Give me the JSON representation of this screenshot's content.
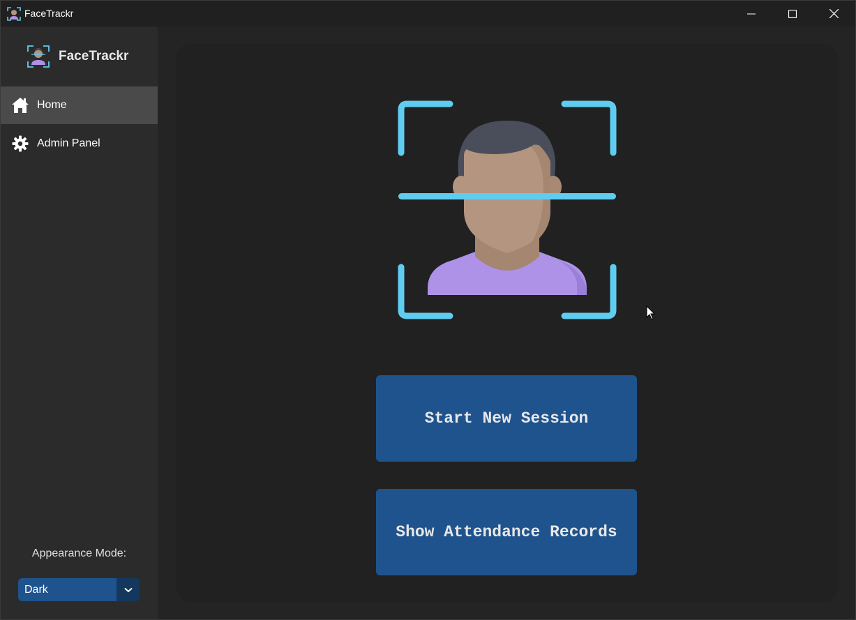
{
  "window": {
    "title": "FaceTrackr",
    "controls": [
      "minimize-icon",
      "maximize-icon",
      "close-icon"
    ]
  },
  "sidebar": {
    "brand": "FaceTrackr",
    "items": [
      {
        "label": "Home",
        "icon": "home-icon",
        "active": true
      },
      {
        "label": "Admin Panel",
        "icon": "gear-icon",
        "active": false
      }
    ],
    "appearance_label": "Appearance Mode:",
    "appearance_value": "Dark"
  },
  "main": {
    "hero_icon": "face-scan-icon",
    "buttons": {
      "start_session": "Start New Session",
      "show_records": "Show Attendance Records"
    }
  },
  "colors": {
    "accent": "#1f538d",
    "accent_dark": "#14375e",
    "scan_frame": "#5fcdf0",
    "shirt": "#ae92e8",
    "skin": "#b49580",
    "hair": "#4a4e5a"
  }
}
